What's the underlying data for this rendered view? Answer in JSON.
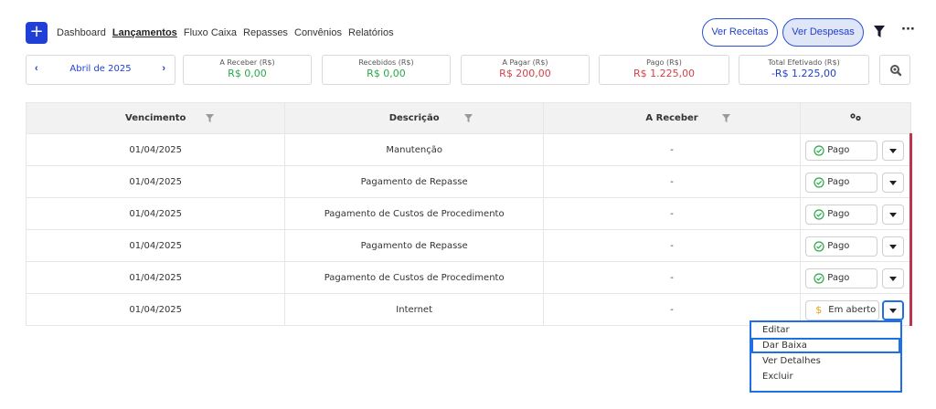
{
  "toolbar": {
    "add_label": "+",
    "nav": [
      "Dashboard",
      "Lançamentos",
      "Fluxo Caixa",
      "Repasses",
      "Convênios",
      "Relatórios"
    ],
    "active_nav": "Lançamentos",
    "ver_receitas": "Ver Receitas",
    "ver_despesas": "Ver Despesas",
    "more_label": "···"
  },
  "summary": {
    "month_prev": "‹",
    "month": "Abril de 2025",
    "month_next": "›",
    "cards": [
      {
        "label": "A Receber (R$)",
        "value": "R$ 0,00"
      },
      {
        "label": "Recebidos (R$)",
        "value": "R$ 0,00"
      },
      {
        "label": "A Pagar (R$)",
        "value": "R$ 200,00"
      },
      {
        "label": "Pago (R$)",
        "value": "R$ 1.225,00"
      },
      {
        "label": "Total Efetivado (R$)",
        "value": "-R$ 1.225,00"
      }
    ]
  },
  "table": {
    "headers": [
      "Vencimento",
      "Descrição",
      "A Receber"
    ],
    "rows": [
      {
        "vencimento": "01/04/2025",
        "descricao": "Manutenção",
        "a_receber": "-",
        "status": "Pago"
      },
      {
        "vencimento": "01/04/2025",
        "descricao": "Pagamento de Repasse",
        "a_receber": "-",
        "status": "Pago"
      },
      {
        "vencimento": "01/04/2025",
        "descricao": "Pagamento de Custos de Procedimento",
        "a_receber": "-",
        "status": "Pago"
      },
      {
        "vencimento": "01/04/2025",
        "descricao": "Pagamento de Repasse",
        "a_receber": "-",
        "status": "Pago"
      },
      {
        "vencimento": "01/04/2025",
        "descricao": "Pagamento de Custos de Procedimento",
        "a_receber": "-",
        "status": "Pago"
      },
      {
        "vencimento": "01/04/2025",
        "descricao": "Internet",
        "a_receber": "-",
        "status": "Em aberto"
      }
    ]
  },
  "dropdown": {
    "items": [
      "Editar",
      "Dar Baixa",
      "Ver Detalhes",
      "Excluir"
    ],
    "selected": "Dar Baixa"
  },
  "icons": {
    "add": "plus-icon",
    "filter": "filter-icon",
    "more": "more-icon",
    "search": "search-icon",
    "gears": "gears-icon",
    "check": "check-circle-icon",
    "dollar": "dollar-icon",
    "caret": "caret-down-icon"
  },
  "colors": {
    "primary": "#1f3fd6",
    "green": "#2aa84a",
    "red": "#d2424a",
    "row_accent": "#c0344d",
    "focus": "#1f6fe6",
    "open_status": "#e3a21a"
  }
}
